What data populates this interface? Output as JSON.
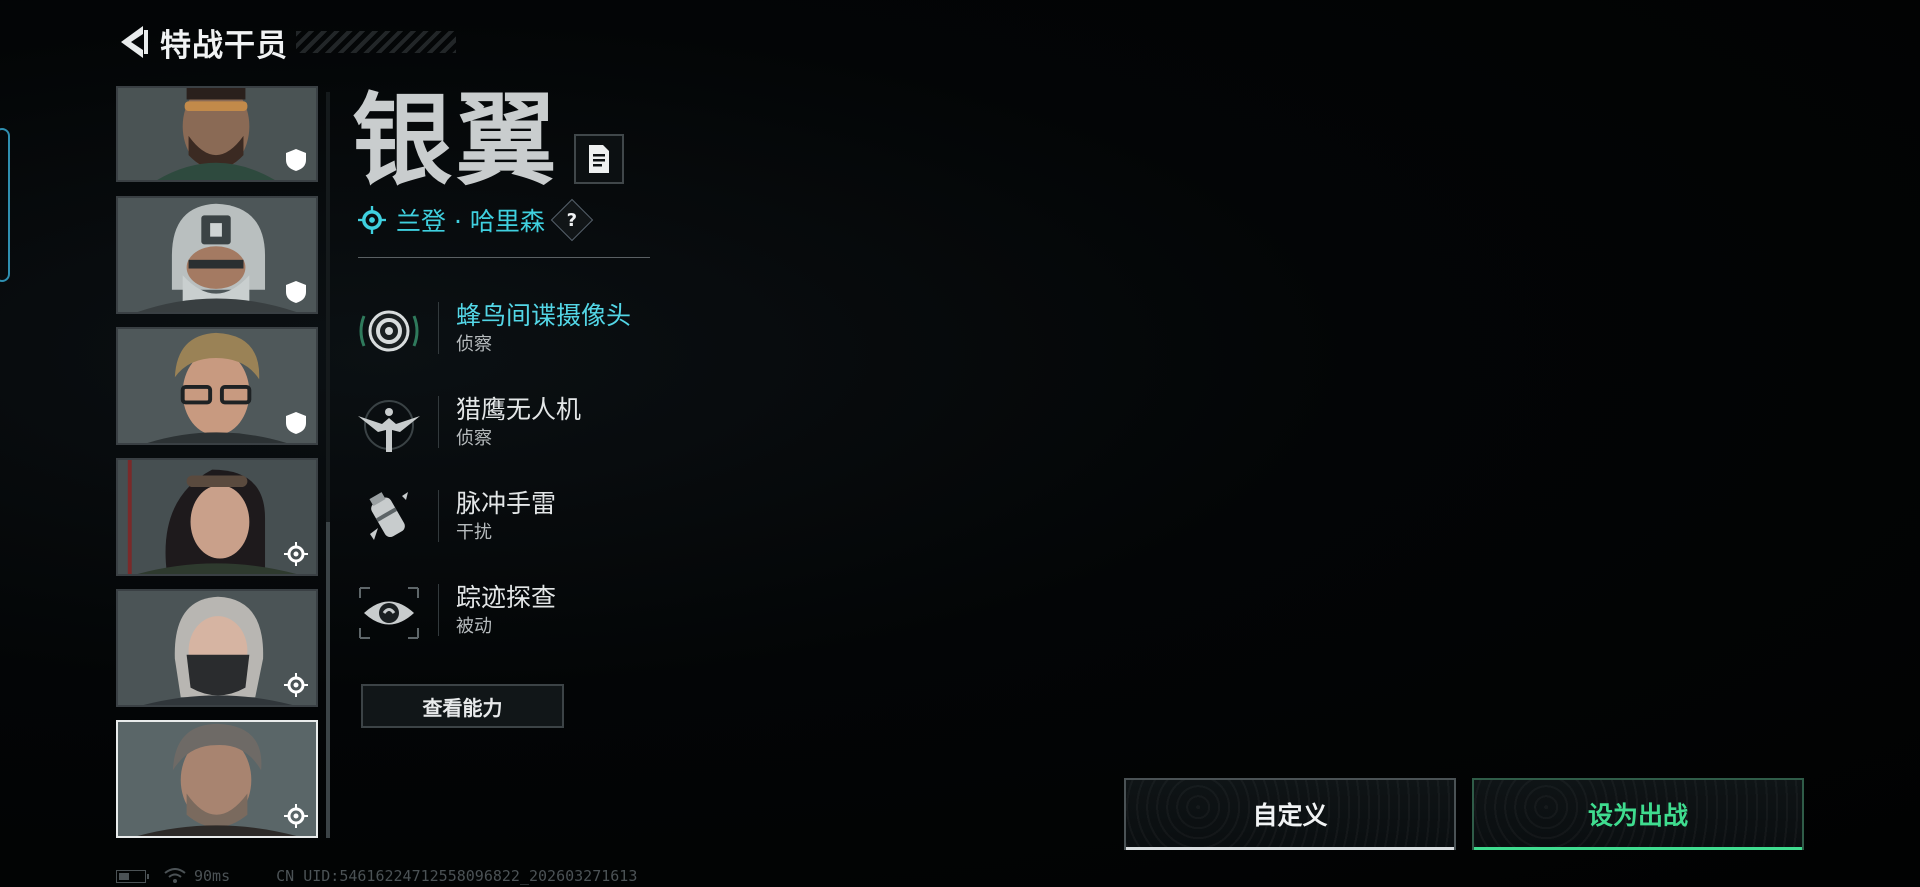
{
  "header": {
    "title": "特战干员"
  },
  "roster": {
    "cards": [
      {
        "role": "shield-icon",
        "selected": false
      },
      {
        "role": "shield-icon",
        "selected": false
      },
      {
        "role": "shield-icon",
        "selected": false
      },
      {
        "role": "recon-target-icon",
        "selected": false
      },
      {
        "role": "recon-target-icon",
        "selected": false
      },
      {
        "role": "recon-target-icon",
        "selected": true
      }
    ]
  },
  "operator": {
    "name": "银翼",
    "real_name": "兰登 · 哈里森",
    "help": "?"
  },
  "abilities": [
    {
      "name": "蜂鸟间谍摄像头",
      "type": "侦察",
      "icon": "spy-camera-icon",
      "active": true
    },
    {
      "name": "猎鹰无人机",
      "type": "侦察",
      "icon": "falcon-drone-icon",
      "active": false
    },
    {
      "name": "脉冲手雷",
      "type": "干扰",
      "icon": "pulse-grenade-icon",
      "active": false
    },
    {
      "name": "踪迹探查",
      "type": "被动",
      "icon": "trace-eye-icon",
      "active": false
    }
  ],
  "view_abilities_label": "查看能力",
  "actions": {
    "custom_label": "自定义",
    "deploy_label": "设为出战"
  },
  "status": {
    "ping": "90ms",
    "uid": "CN UID:546162247125580968​22_202603271613"
  },
  "colors": {
    "accent_cyan": "#3fd0df",
    "deploy_green": "#3fdc8f"
  }
}
